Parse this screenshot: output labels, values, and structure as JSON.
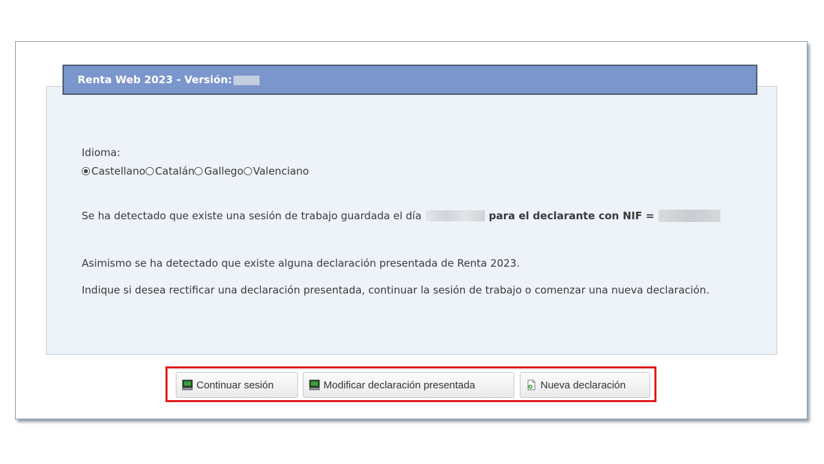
{
  "header": {
    "title": "Renta Web 2023 - Versión:"
  },
  "language": {
    "label": "Idioma:",
    "options": [
      {
        "label": "Castellano",
        "selected": true
      },
      {
        "label": "Catalán",
        "selected": false
      },
      {
        "label": "Gallego",
        "selected": false
      },
      {
        "label": "Valenciano",
        "selected": false
      }
    ]
  },
  "messages": {
    "session_prefix": "Se ha detectado que existe una sesión de trabajo guardada el día",
    "session_bold": "para el declarante con NIF =",
    "asimismo": "Asimismo se ha detectado que existe alguna declaración presentada de Renta 2023.",
    "indique": "Indique si desea rectificar una declaración presentada, continuar la sesión de trabajo o comenzar una nueva declaración."
  },
  "buttons": {
    "continuar": {
      "label": "Continuar sesión",
      "icon": "computer-icon"
    },
    "modificar": {
      "label": "Modificar declaración presentada",
      "icon": "computer-icon"
    },
    "nueva": {
      "label": "Nueva declaración",
      "icon": "new-document-icon"
    }
  },
  "colors": {
    "header_bg": "#7b96cc",
    "panel_bg": "#eef2f9",
    "highlight": "#e01b1b"
  }
}
